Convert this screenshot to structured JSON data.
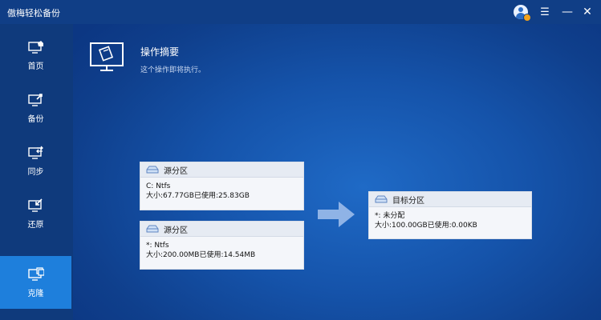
{
  "titlebar": {
    "app_title": "傲梅轻松备份",
    "menu_glyph": "☰",
    "minimize_glyph": "—",
    "close_glyph": "✕"
  },
  "sidebar": {
    "items": [
      {
        "label": "首页",
        "icon": "home-monitor-icon",
        "active": false
      },
      {
        "label": "备份",
        "icon": "backup-icon",
        "active": false
      },
      {
        "label": "同步",
        "icon": "sync-icon",
        "active": false
      },
      {
        "label": "还原",
        "icon": "restore-icon",
        "active": false
      },
      {
        "label": "克隆",
        "icon": "clone-icon",
        "active": true
      }
    ]
  },
  "main": {
    "title": "操作摘要",
    "subtitle": "这个操作即将执行。",
    "source_cards": [
      {
        "header": "源分区",
        "line1": "C: Ntfs",
        "line2": "大小:67.77GB已使用:25.83GB"
      },
      {
        "header": "源分区",
        "line1": "*: Ntfs",
        "line2": "大小:200.00MB已使用:14.54MB"
      }
    ],
    "target_card": {
      "header": "目标分区",
      "line1": "*: 未分配",
      "line2": "大小:100.00GB已使用:0.00KB"
    }
  },
  "colors": {
    "accent_active": "#1e7fdc",
    "sidebar_bg": "#0f3a7c",
    "arrow": "#8fb3e6"
  }
}
